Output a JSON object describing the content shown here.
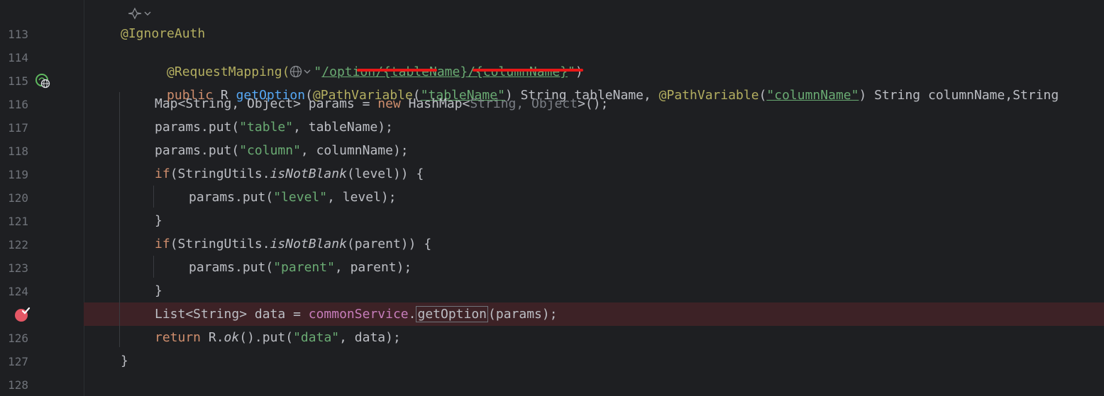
{
  "lines": [
    {
      "num": "113",
      "text": "@IgnoreAuth"
    },
    {
      "num": "114",
      "ann": "@RequestMapping(",
      "q1": "\"",
      "path": "/option/{tableName}/{columnName}",
      "q2": "\"",
      "close": ")"
    },
    {
      "num": "115",
      "kw": "public",
      "t1": " R ",
      "fn": "getOption",
      "t2": "(",
      "ann1": "@PathVariable",
      "t3": "(",
      "s1": "\"tableName\"",
      "t4": ") String tableName, ",
      "ann2": "@PathVariable",
      "t5": "(",
      "s2": "\"columnName\"",
      "t6": ") String columnName,String"
    },
    {
      "num": "116",
      "t1": "Map<String, Object> params = ",
      "kw": "new",
      "t2": " HashMap<",
      "gray": "String, Object",
      "t3": ">();"
    },
    {
      "num": "117",
      "t1": "params.put(",
      "s": "\"table\"",
      "t2": ", tableName);"
    },
    {
      "num": "118",
      "t1": "params.put(",
      "s": "\"column\"",
      "t2": ", columnName);"
    },
    {
      "num": "119",
      "kw": "if",
      "t1": "(StringUtils.",
      "it": "isNotBlank",
      "t2": "(level)) {"
    },
    {
      "num": "120",
      "t1": "params.put(",
      "s": "\"level\"",
      "t2": ", level);"
    },
    {
      "num": "121",
      "t1": "}"
    },
    {
      "num": "122",
      "kw": "if",
      "t1": "(StringUtils.",
      "it": "isNotBlank",
      "t2": "(parent)) {"
    },
    {
      "num": "123",
      "t1": "params.put(",
      "s": "\"parent\"",
      "t2": ", parent);"
    },
    {
      "num": "124",
      "t1": "}"
    },
    {
      "num": "125",
      "t1": "List<String> data = ",
      "field": "commonService",
      "t2": ".",
      "hl": "getOption",
      "t3": "(params);"
    },
    {
      "num": "126",
      "kw": "return",
      "t1": " R.",
      "it": "ok",
      "t2": "().put(",
      "s": "\"data\"",
      "t3": ", data);"
    },
    {
      "num": "127",
      "t1": "}"
    },
    {
      "num": "128",
      "t1": ""
    }
  ],
  "icons": {
    "ai_hint": "sparkle-icon",
    "globe": "globe-icon",
    "endpoint": "web-endpoint-icon",
    "breakpoint": "breakpoint-icon"
  },
  "colors": {
    "background": "#1e1f22",
    "breakpoint_line": "#3d2226",
    "annotation_underline": "#e81717"
  }
}
